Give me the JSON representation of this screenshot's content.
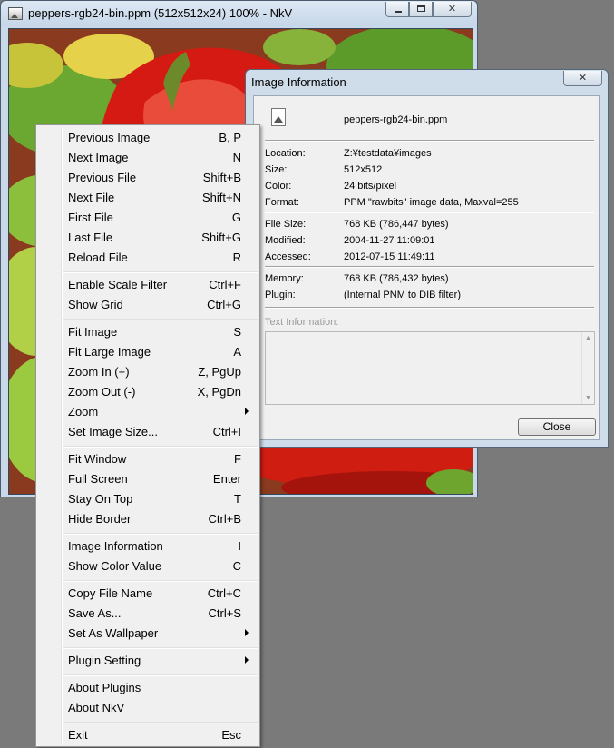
{
  "main_window": {
    "title": "peppers-rgb24-bin.ppm  (512x512x24) 100% - NkV",
    "icons": {
      "app": "image-icon",
      "minimize": "minimize-icon",
      "maximize": "maximize-icon",
      "close": "close-icon"
    },
    "close_glyph": "✕"
  },
  "info_dialog": {
    "title": "Image Information",
    "close_glyph": "✕",
    "file_name": "peppers-rgb24-bin.ppm",
    "group1": [
      {
        "label": "Location:",
        "value": "Z:¥testdata¥images"
      },
      {
        "label": "Size:",
        "value": "512x512"
      },
      {
        "label": "Color:",
        "value": "24 bits/pixel"
      },
      {
        "label": "Format:",
        "value": "PPM \"rawbits\" image data, Maxval=255"
      }
    ],
    "group2": [
      {
        "label": "File Size:",
        "value": "768 KB (786,447 bytes)"
      },
      {
        "label": "Modified:",
        "value": "2004-11-27 11:09:01"
      },
      {
        "label": "Accessed:",
        "value": "2012-07-15 11:49:11"
      }
    ],
    "group3": [
      {
        "label": "Memory:",
        "value": "768 KB (786,432 bytes)"
      },
      {
        "label": "Plugin:",
        "value": "(Internal PNM to DIB filter)"
      }
    ],
    "text_info_label": "Text Information:",
    "close_button": "Close"
  },
  "context_menu": {
    "items": [
      {
        "label": "Previous Image",
        "shortcut": "B, P"
      },
      {
        "label": "Next Image",
        "shortcut": "N"
      },
      {
        "label": "Previous File",
        "shortcut": "Shift+B"
      },
      {
        "label": "Next File",
        "shortcut": "Shift+N"
      },
      {
        "label": "First File",
        "shortcut": "G"
      },
      {
        "label": "Last File",
        "shortcut": "Shift+G"
      },
      {
        "label": "Reload File",
        "shortcut": "R"
      },
      {
        "label": "Enable Scale Filter",
        "shortcut": "Ctrl+F"
      },
      {
        "label": "Show Grid",
        "shortcut": "Ctrl+G"
      },
      {
        "label": "Fit Image",
        "shortcut": "S"
      },
      {
        "label": "Fit Large Image",
        "shortcut": "A"
      },
      {
        "label": "Zoom In (+)",
        "shortcut": "Z, PgUp"
      },
      {
        "label": "Zoom Out (-)",
        "shortcut": "X, PgDn"
      },
      {
        "label": "Zoom",
        "shortcut": ""
      },
      {
        "label": "Set Image Size...",
        "shortcut": "Ctrl+I"
      },
      {
        "label": "Fit Window",
        "shortcut": "F"
      },
      {
        "label": "Full Screen",
        "shortcut": "Enter"
      },
      {
        "label": "Stay On Top",
        "shortcut": "T"
      },
      {
        "label": "Hide Border",
        "shortcut": "Ctrl+B"
      },
      {
        "label": "Image Information",
        "shortcut": "I"
      },
      {
        "label": "Show Color Value",
        "shortcut": "C"
      },
      {
        "label": "Copy File Name",
        "shortcut": "Ctrl+C"
      },
      {
        "label": "Save As...",
        "shortcut": "Ctrl+S"
      },
      {
        "label": "Set As Wallpaper",
        "shortcut": ""
      },
      {
        "label": "Plugin Setting",
        "shortcut": ""
      },
      {
        "label": "About Plugins",
        "shortcut": ""
      },
      {
        "label": "About NkV",
        "shortcut": ""
      },
      {
        "label": "Exit",
        "shortcut": "Esc"
      }
    ]
  }
}
